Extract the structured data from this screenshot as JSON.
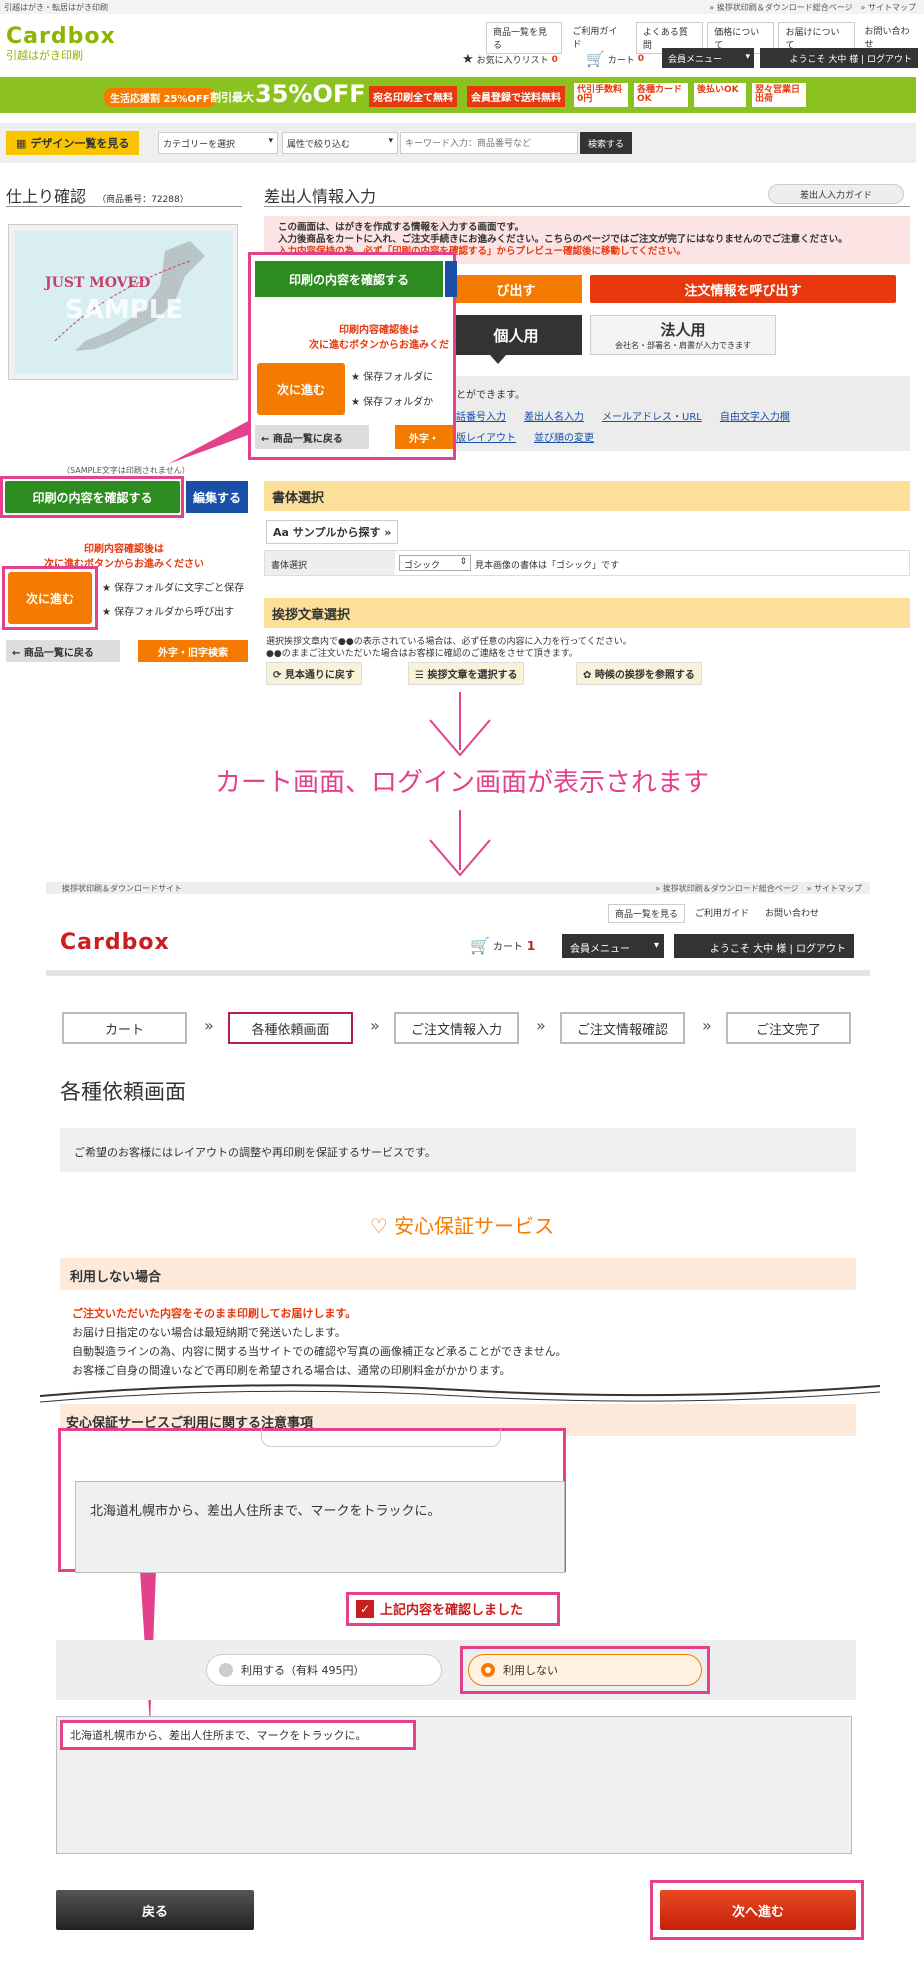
{
  "top": {
    "left_text": "引越はがき・転居はがき印刷",
    "right_text": "» 挨拶状印刷＆ダウンロード総合ページ　» サイトマップ"
  },
  "logo": {
    "main": "Cardbox",
    "sub": "引越はがき印刷"
  },
  "header": {
    "links": [
      "商品一覧を見る",
      "ご利用ガイド",
      "よくある質問",
      "価格について",
      "お届けについて",
      "お問い合わせ"
    ],
    "fav": "お気に入りリスト",
    "fav_count": "0",
    "cart": "カート",
    "cart_count": "0",
    "member_menu": "会員メニュー",
    "welcome": "ようこそ 大中 様",
    "logout": "ログアウト"
  },
  "banner": {
    "b1": "生活応援割 25%OFF",
    "b2": "割引最大",
    "b3": "35%OFF",
    "b4": "宛名印刷全て無料",
    "b5": "会員登録で送料無料",
    "b6": "代引手数料0円",
    "b7": "各種カードOK",
    "b8": "後払いOK",
    "b9": "翌々営業日出荷"
  },
  "search": {
    "design_btn": "デザイン一覧を見る",
    "category": "カテゴリーを選択",
    "attr": "属性で絞り込む",
    "placeholder": "キーワード入力：商品番号など",
    "btn": "検索する"
  },
  "left": {
    "title": "仕上り確認",
    "code": "（商品番号：72288）",
    "preview_title": "JUST MOVED",
    "preview_sample": "SAMPLE",
    "note": "（SAMPLE文字は印刷されません）",
    "confirm_btn": "印刷の内容を確認する",
    "edit_btn": "編集する",
    "warn1": "印刷内容確認後は",
    "warn2": "次に進むボタンからお進みください",
    "next_btn": "次に進む",
    "save1": "保存フォルダに文字ごと保存",
    "save2": "保存フォルダから呼び出す",
    "back_btn": "商品一覧に戻る",
    "gaiji_btn": "外字・旧字検索"
  },
  "zoom": {
    "confirm_btn": "印刷の内容を確認する",
    "warn1": "印刷内容確認後は",
    "warn2": "次に進むボタンからお進みくだ",
    "next_btn": "次に進む",
    "save1": "保存フォルダに",
    "save2": "保存フォルダか",
    "back_btn": "商品一覧に戻る",
    "gaiji_btn": "外字・"
  },
  "right": {
    "title": "差出人情報入力",
    "guide_btn": "差出人入力ガイド",
    "info1": "この画面は、はがきを作成する情報を入力する画面です。",
    "info2": "入力後商品をカートに入れ、ご注文手続きにお進みください。こちらのページではご注文が完了にはなりませんのでご注意ください。",
    "info3": "入力内容保持の為、必ず「印刷の内容を確認する」からプレビュー確認後に移動してください。",
    "call_btn": "び出す",
    "order_call_btn": "注文情報を呼び出す",
    "tab_personal": "個人用",
    "tab_corp": "法人用",
    "tab_corp_sub": "会社名・部署名・肩書が入力できます",
    "edit_note": "とができます。",
    "links": [
      "話番号入力",
      "差出人名入力",
      "メールアドレス・URL",
      "自由文字入力欄"
    ],
    "links2": [
      "版レイアウト",
      "並び順の変更"
    ],
    "font_section": "書体選択",
    "sample_btn": "サンプルから探す",
    "font_label": "書体選択",
    "font_value": "ゴシック",
    "font_note": "見本画像の書体は「ゴシック」です",
    "greet_section": "挨拶文章選択",
    "greet_note1": "選択挨拶文章内で●●の表示されている場合は、必ず任意の内容に入力を行ってください。",
    "greet_note2": "●●のままご注文いただいた場合はお客様に確認のご連絡をさせて頂きます。",
    "greet_btn1": "見本通りに戻す",
    "greet_btn2": "挨拶文章を選択する",
    "greet_btn3": "時候の挨拶を参照する"
  },
  "caption": "カート画面、ログイン画面が表示されます",
  "cart": {
    "top_left": "挨拶状印刷＆ダウンロードサイト",
    "top_right": "» 挨拶状印刷＆ダウンロード総合ページ　» サイトマップ",
    "links": [
      "商品一覧を見る",
      "ご利用ガイド",
      "お問い合わせ"
    ],
    "cart": "カート",
    "cart_count": "1",
    "member_menu": "会員メニュー",
    "welcome": "ようこそ 大中 様",
    "logout": "ログアウト",
    "steps": [
      "カート",
      "各種依頼画面",
      "ご注文情報入力",
      "ご注文情報確認",
      "ご注文完了"
    ],
    "page_title": "各種依頼画面",
    "desc": "ご希望のお客様にはレイアウトの調整や再印刷を保証するサービスです。",
    "service_title": "安心保証サービス",
    "no_use_title": "利用しない場合",
    "no_use_red": "ご注文いただいた内容をそのまま印刷してお届けします。",
    "no_use_1": "お届け日指定のない場合は最短納期で発送いたします。",
    "no_use_2": "自動製造ラインの為、内容に関する当サイトでの確認や写真の画像補正など承ることができません。",
    "no_use_3": "お客様ご自身の間違いなどで再印刷を希望される場合は、通常の印刷料金がかかります。",
    "caution_title": "安心保証サービスご利用に関する注意事項",
    "request_text": "北海道札幌市から、差出人住所まで、マークをトラックに。",
    "confirm_check": "上記内容を確認しました",
    "opt_use": "利用する（有料 495円）",
    "opt_nouse": "利用しない",
    "back_btn": "戻る",
    "next_btn": "次へ進む"
  }
}
